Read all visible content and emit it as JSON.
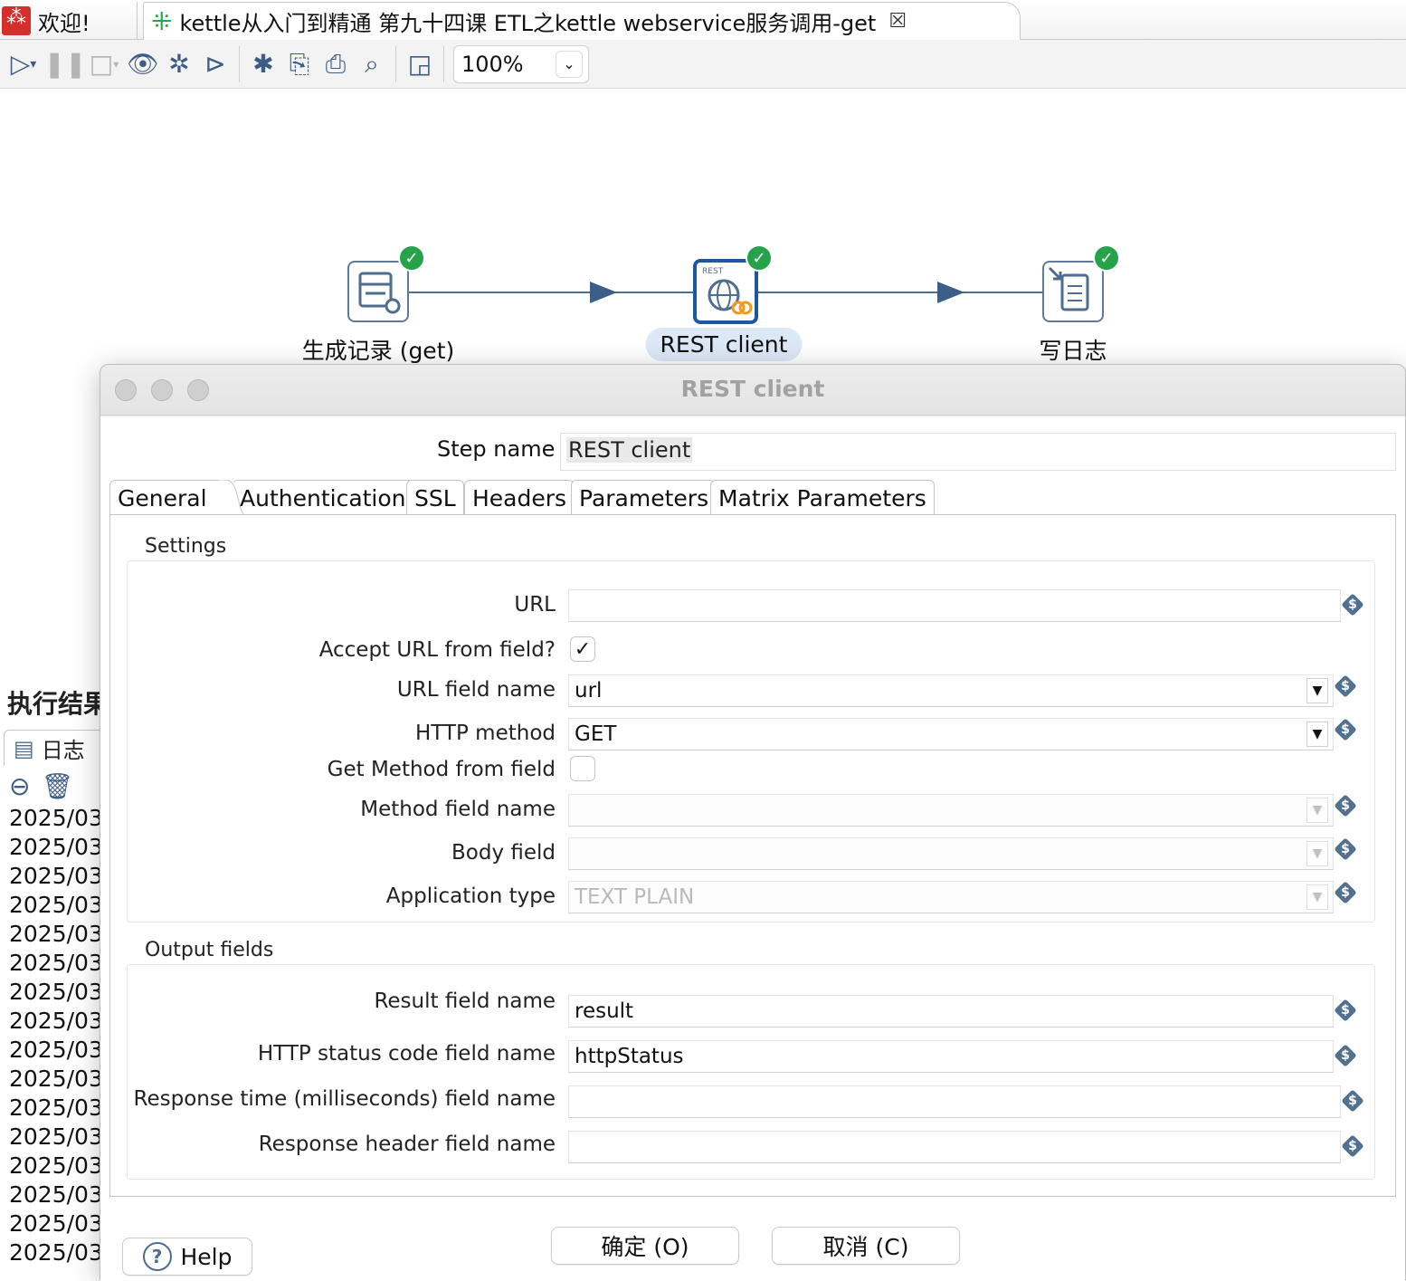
{
  "editor_tabs": {
    "welcome": "欢迎!",
    "active": "kettle从入门到精通 第九十四课 ETL之kettle webservice服务调用-get",
    "close_glyph": "☒"
  },
  "toolbar": {
    "zoom": "100%"
  },
  "canvas": {
    "steps": [
      {
        "label": "生成记录 (get)",
        "icon": "generate-rows-icon",
        "status": "ok"
      },
      {
        "label": "REST client",
        "icon": "rest-client-icon",
        "status": "ok",
        "selected": true
      },
      {
        "label": "写日志",
        "icon": "write-to-log-icon",
        "status": "ok"
      }
    ]
  },
  "exec_panel": {
    "title": "执行结果",
    "tab": "日志",
    "log_lines": [
      "2025/03",
      "2025/03",
      "2025/03",
      "2025/03",
      "2025/03",
      "2025/03",
      "2025/03",
      "2025/03",
      "2025/03",
      "2025/03",
      "2025/03",
      "2025/03",
      "2025/03",
      "2025/03",
      "2025/03",
      "2025/03"
    ]
  },
  "dialog": {
    "title": "REST client",
    "step_name_label": "Step name",
    "step_name_value": "REST client",
    "tabs": [
      "General",
      "Authentication",
      "SSL",
      "Headers",
      "Parameters",
      "Matrix Parameters"
    ],
    "active_tab": "General",
    "settings": {
      "group_label": "Settings",
      "url_label": "URL",
      "url_value": "",
      "accept_url_label": "Accept URL from field?",
      "accept_url_checked": true,
      "url_field_label": "URL field name",
      "url_field_value": "url",
      "http_method_label": "HTTP method",
      "http_method_value": "GET",
      "get_method_label": "Get Method from field",
      "get_method_checked": false,
      "method_field_label": "Method field name",
      "method_field_value": "",
      "body_field_label": "Body field",
      "body_field_value": "",
      "app_type_label": "Application type",
      "app_type_value": "TEXT PLAIN"
    },
    "output": {
      "group_label": "Output fields",
      "result_label": "Result field name",
      "result_value": "result",
      "status_label": "HTTP status code field name",
      "status_value": "httpStatus",
      "response_time_label": "Response time (milliseconds) field name",
      "response_time_value": "",
      "response_header_label": "Response header field name",
      "response_header_value": ""
    },
    "buttons": {
      "help": "Help",
      "ok": "确定 (O)",
      "cancel": "取消 (C)"
    }
  },
  "colors": {
    "accent": "#1c57a3",
    "hop": "#4c6f95",
    "ok_badge": "#25a24a"
  }
}
